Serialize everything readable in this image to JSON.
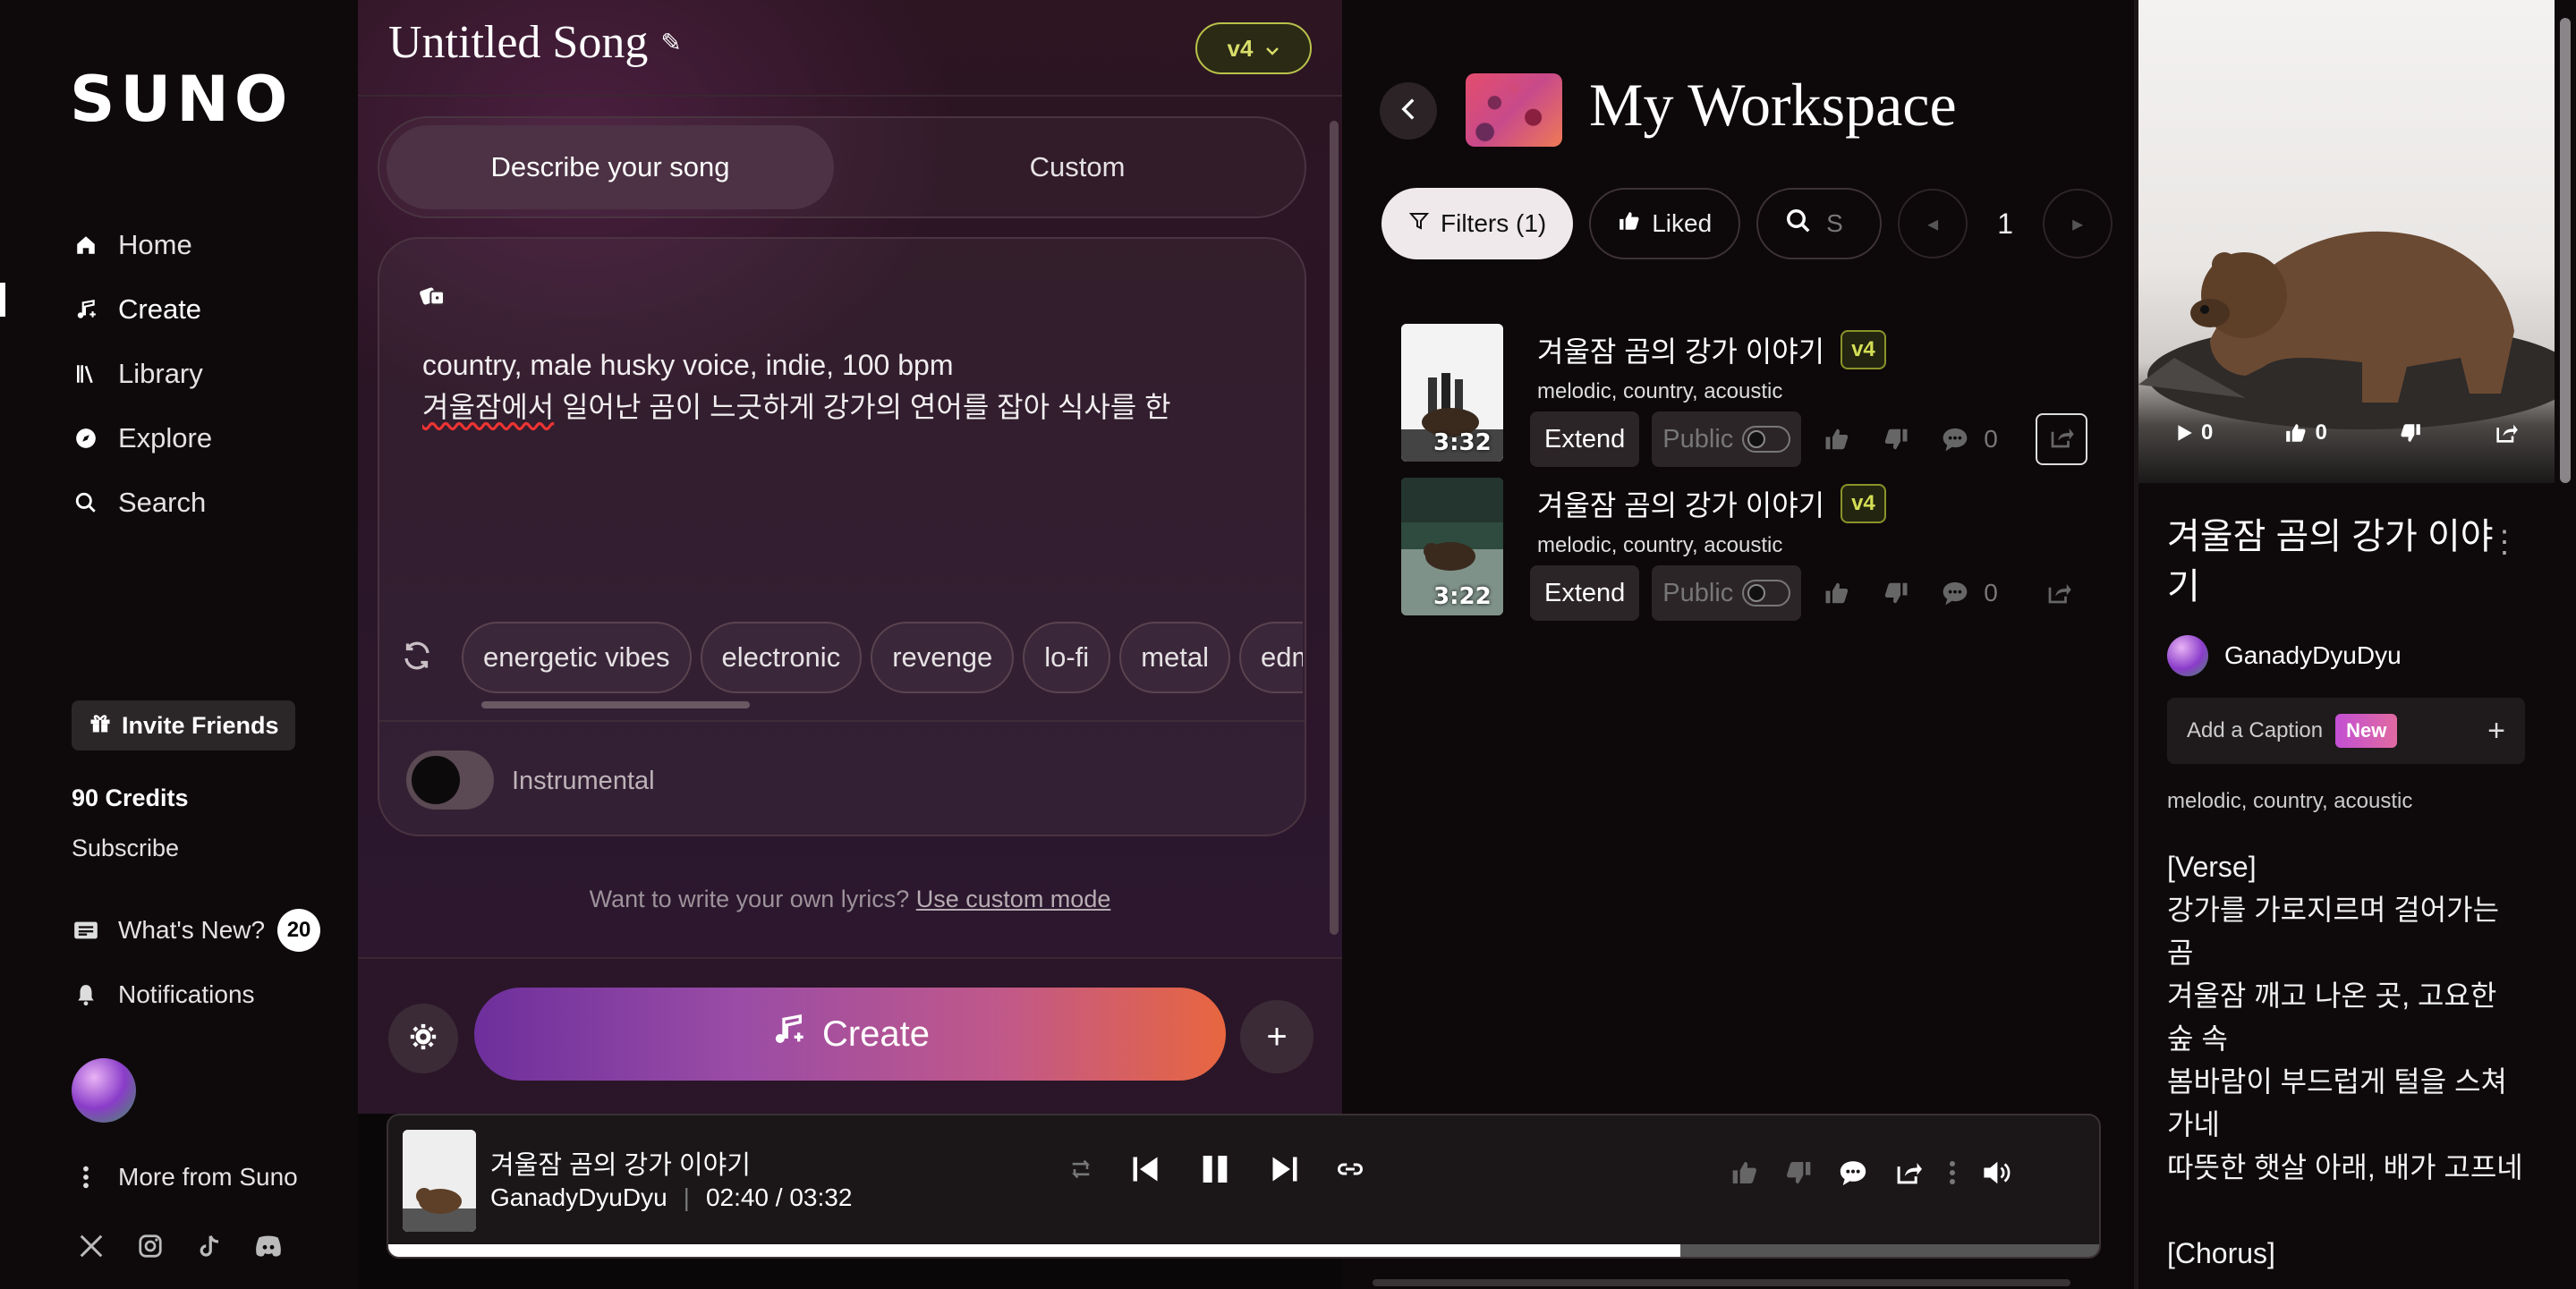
{
  "sidebar": {
    "logo": "SUNO",
    "nav": [
      {
        "label": "Home",
        "icon": "home-icon"
      },
      {
        "label": "Create",
        "icon": "music-note-icon"
      },
      {
        "label": "Library",
        "icon": "library-icon"
      },
      {
        "label": "Explore",
        "icon": "compass-icon"
      },
      {
        "label": "Search",
        "icon": "search-icon"
      }
    ],
    "invite_label": "Invite Friends",
    "credits": "90 Credits",
    "subscribe": "Subscribe",
    "whats_new": "What's New?",
    "whats_new_count": "20",
    "notifications": "Notifications",
    "more_from": "More from Suno"
  },
  "create": {
    "title": "Untitled Song",
    "model": "v4",
    "tab_describe": "Describe your song",
    "tab_custom": "Custom",
    "prompt_line1": "country, male husky voice, indie, 100 bpm",
    "prompt_line2_word": "겨울잠에서",
    "prompt_line2_rest": " 일어난 곰이 느긋하게 강가의 연어를 잡아 식사를 한",
    "tags": [
      "energetic vibes",
      "electronic",
      "revenge",
      "lo-fi",
      "metal",
      "edm"
    ],
    "instrumental": "Instrumental",
    "hint_text": "Want to write your own lyrics?",
    "hint_link": "Use custom mode",
    "create_label": "Create"
  },
  "workspace": {
    "title": "My Workspace",
    "filters": "Filters (1)",
    "liked": "Liked",
    "search_placeholder": "S",
    "page": "1",
    "clips": [
      {
        "title": "겨울잠 곰의 강가 이야기",
        "version": "v4",
        "genre": "melodic, country, acoustic",
        "duration": "3:32",
        "extend": "Extend",
        "public": "Public",
        "comments": "0"
      },
      {
        "title": "겨울잠 곰의 강가 이야기",
        "version": "v4",
        "genre": "melodic, country, acoustic",
        "duration": "3:22",
        "extend": "Extend",
        "public": "Public",
        "comments": "0"
      }
    ]
  },
  "detail": {
    "plays": "0",
    "likes": "0",
    "title": "겨울잠 곰의 강가 이야기",
    "creator": "GanadyDyuDyu",
    "add_caption": "Add a Caption",
    "new_badge": "New",
    "genre": "melodic, country, acoustic",
    "lyrics": "[Verse]\n강가를 가로지르며 걸어가는 곰\n겨울잠 깨고 나온 곳, 고요한 숲 속\n봄바람이 부드럽게 털을 스쳐가네\n따뜻한 햇살 아래, 배가 고프네\n\n[Chorus]"
  },
  "player": {
    "title": "겨울잠 곰의 강가 이야기",
    "artist": "GanadyDyuDyu",
    "time": "02:40 / 03:32",
    "progress": 0.755
  }
}
